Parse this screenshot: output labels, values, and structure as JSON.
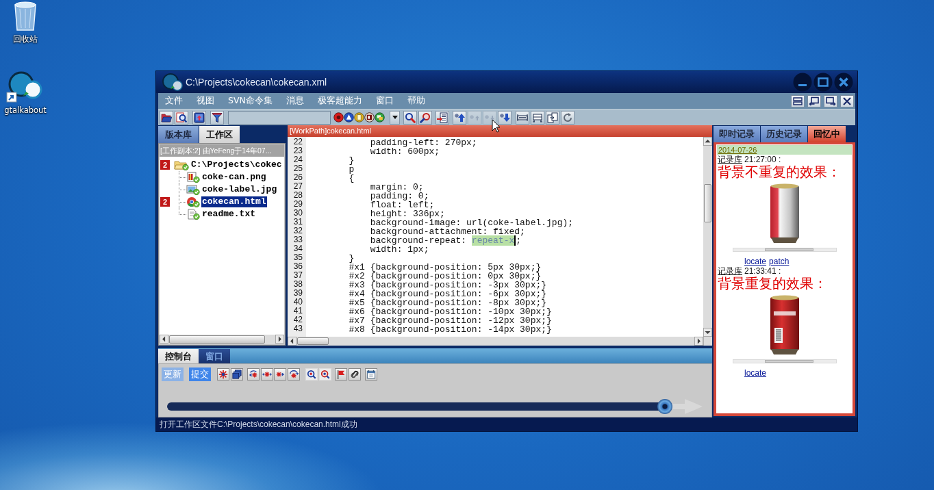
{
  "desktop": {
    "icons": [
      {
        "label": "回收站",
        "kind": "recycle-bin"
      },
      {
        "label": "gtalkabout",
        "kind": "shortcut"
      }
    ]
  },
  "window": {
    "title": "C:\\Projects\\cokecan\\cokecan.xml"
  },
  "menu": [
    "文件",
    "视图",
    "SVN命令集",
    "消息",
    "极客超能力",
    "窗口",
    "帮助"
  ],
  "toolbar": {
    "buttons": [
      {
        "disabled": false
      },
      {
        "disabled": false
      },
      {
        "disabled": false
      },
      {
        "disabled": false
      },
      {
        "disabled": false
      },
      {
        "disabled": false
      },
      {
        "disabled": false
      },
      {
        "disabled": false
      },
      {
        "disabled": false
      },
      {
        "disabled": false
      },
      {
        "disabled": false
      },
      {
        "disabled": false
      },
      {
        "disabled": false
      },
      {
        "disabled": false
      },
      {
        "disabled": true
      },
      {
        "disabled": true
      },
      {
        "disabled": false
      },
      {
        "disabled": false
      },
      {
        "disabled": false
      },
      {
        "disabled": false
      },
      {
        "disabled": false
      }
    ]
  },
  "left_panel": {
    "tabs": [
      {
        "label": "版本库",
        "selected": false
      },
      {
        "label": "工作区",
        "selected": true
      }
    ],
    "header": "[工作副本:2] 由YeFeng于14年07...",
    "tree": [
      {
        "label": "C:\\Projects\\cokec",
        "kind": "folder",
        "badge": "2",
        "selected": false,
        "children": [
          {
            "label": "coke-can.png",
            "kind": "png",
            "selected": false
          },
          {
            "label": "coke-label.jpg",
            "kind": "jpg",
            "selected": false
          },
          {
            "label": "cokecan.html",
            "kind": "html",
            "badge": "2",
            "selected": true
          },
          {
            "label": "readme.txt",
            "kind": "txt",
            "selected": false
          }
        ]
      }
    ]
  },
  "editor": {
    "title": "[WorkPath]cokecan.html",
    "lines": [
      {
        "number": "22",
        "text": "            padding-left: 270px;"
      },
      {
        "number": "23",
        "text": "            width: 600px;"
      },
      {
        "number": "24",
        "text": "        }"
      },
      {
        "number": "25",
        "text": "        p"
      },
      {
        "number": "26",
        "text": "        {"
      },
      {
        "number": "27",
        "text": "            margin: 0;"
      },
      {
        "number": "28",
        "text": "            padding: 0;"
      },
      {
        "number": "29",
        "text": "            float: left;"
      },
      {
        "number": "30",
        "text": "            height: 336px;"
      },
      {
        "number": "31",
        "text": "            background-image: url(coke-label.jpg);"
      },
      {
        "number": "32",
        "text": "            background-attachment: fixed;"
      },
      {
        "number": "33",
        "segments": [
          {
            "text": "            background-repeat: ",
            "selected": false,
            "caret": false
          },
          {
            "text": "repeat-x",
            "selected": true,
            "caret": true
          },
          {
            "text": ";",
            "selected": false,
            "caret": false
          }
        ]
      },
      {
        "number": "34",
        "text": "            width: 1px;"
      },
      {
        "number": "35",
        "text": "        }"
      },
      {
        "number": "36",
        "text": "        #x1 {background-position: 5px 30px;}"
      },
      {
        "number": "37",
        "text": "        #x2 {background-position: 0px 30px;}"
      },
      {
        "number": "38",
        "text": "        #x3 {background-position: -3px 30px;}"
      },
      {
        "number": "39",
        "text": "        #x4 {background-position: -6px 30px;}"
      },
      {
        "number": "40",
        "text": "        #x5 {background-position: -8px 30px;}"
      },
      {
        "number": "41",
        "text": "        #x6 {background-position: -10px 30px;}"
      },
      {
        "number": "42",
        "text": "        #x7 {background-position: -12px 30px;}"
      },
      {
        "number": "43",
        "text": "        #x8 {background-position: -14px 30px;}"
      }
    ]
  },
  "right_panel": {
    "tabs": [
      {
        "label": "即时记录",
        "selected": false
      },
      {
        "label": "历史记录",
        "selected": false
      },
      {
        "label": "回忆中",
        "selected": true
      }
    ],
    "date": "2014-07-26",
    "entries": [
      {
        "source": "记录库",
        "time": "21:27:00 :",
        "message": "背景不重复的效果：",
        "kind": "silver-can",
        "links": [
          "locate",
          "patch"
        ]
      },
      {
        "source": "记录库",
        "time": "21:33:41 :",
        "message": "背景重复的效果：",
        "kind": "red-can",
        "links": [
          "locate"
        ]
      }
    ]
  },
  "console": {
    "tabs": [
      {
        "label": "控制台",
        "selected": true
      },
      {
        "label": "窗口",
        "selected": false
      }
    ],
    "buttons": [
      {
        "label": "更新",
        "disabled": true
      },
      {
        "label": "提交",
        "disabled": false
      }
    ],
    "slider": {
      "level": 0.93
    }
  },
  "status_bar": "打开工作区文件C:\\Projects\\cokecan\\cokecan.html成功"
}
